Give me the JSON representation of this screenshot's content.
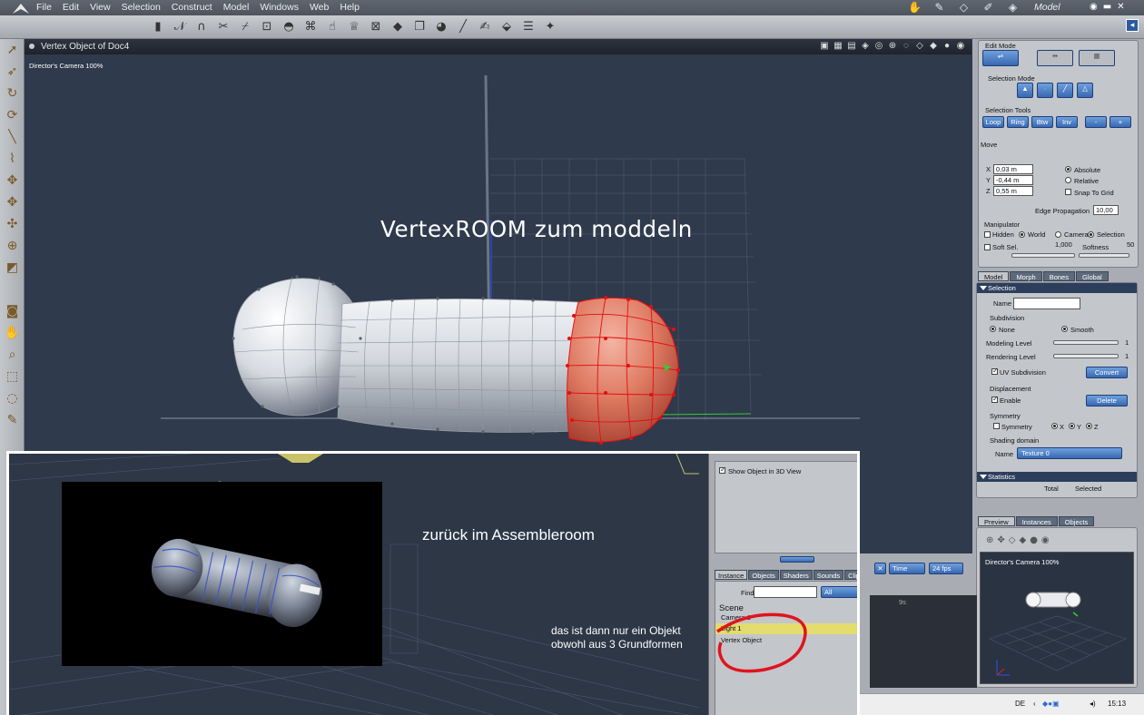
{
  "app": {
    "menu": [
      "File",
      "Edit",
      "View",
      "Selection",
      "Construct",
      "Model",
      "Windows",
      "Web",
      "Help"
    ],
    "room": "Model"
  },
  "viewport": {
    "title": "Vertex Object of Doc4",
    "camera_label": "Director's Camera 100%",
    "annotation": "VertexROOM zum moddeln"
  },
  "edit_panel": {
    "edit_mode_label": "Edit Mode",
    "selection_mode_label": "Selection Mode",
    "selection_tools_label": "Selection Tools",
    "selection_tools": [
      "Loop",
      "Ring",
      "Btw",
      "Inv",
      "-",
      "+"
    ],
    "move_label": "Move",
    "coords": [
      {
        "axis": "X",
        "value": "0,03 m"
      },
      {
        "axis": "Y",
        "value": "-0,44 m"
      },
      {
        "axis": "Z",
        "value": "0,55 m"
      }
    ],
    "absolute": "Absolute",
    "relative": "Relative",
    "snap": "Snap To Grid",
    "edge_propagation_label": "Edge Propagation",
    "edge_propagation_value": "10,00",
    "manipulator_label": "Manipulator",
    "manip_options": [
      "Hidden",
      "World",
      "Camera",
      "Selection"
    ],
    "soft_sel": "Soft Sel.",
    "soft_sel_value": "1,000",
    "softness": "Softness",
    "softness_value": "50"
  },
  "props_panel": {
    "tabs": [
      "Model",
      "Morph",
      "Bones",
      "Global"
    ],
    "selection_header": "Selection",
    "name_label": "Name",
    "subdivision_label": "Subdivision",
    "none": "None",
    "smooth": "Smooth",
    "modeling_level": "Modeling Level",
    "modeling_level_value": "1",
    "rendering_level": "Rendering Level",
    "rendering_level_value": "1",
    "uv_subdivision": "UV Subdivision",
    "convert": "Convert",
    "displacement_label": "Displacement",
    "enable": "Enable",
    "delete": "Delete",
    "symmetry_label": "Symmetry",
    "symmetry": "Symmetry",
    "sym_axes": [
      "X",
      "Y",
      "Z"
    ],
    "shading_domain_label": "Shading domain",
    "shading_name_label": "Name",
    "shading_value": "Texture 0",
    "statistics_header": "Statistics",
    "total": "Total",
    "selected": "Selected"
  },
  "preview_panel": {
    "tabs": [
      "Preview",
      "Instances",
      "Objects"
    ],
    "camera_label": "Director's Camera 100%"
  },
  "bottom": {
    "time_label": "Time",
    "fps_label": "24 fps",
    "timeline_mark": "9s"
  },
  "inset": {
    "show_object": "Show Object in 3D View",
    "tabs": [
      "Instance",
      "Objects",
      "Shaders",
      "Sounds",
      "Clip"
    ],
    "find_label": "Find:",
    "find_filter": "All",
    "scene_label": "Scene",
    "scene_items": [
      "Camera 1",
      "Light 1",
      "Vertex Object"
    ],
    "assemble_text": "zurück im Assembleroom",
    "note_line1": "das ist dann nur ein Objekt",
    "note_line2": "obwohl aus 3 Grundformen"
  },
  "taskbar": {
    "lang": "DE",
    "time": "15:13"
  },
  "colors": {
    "viewport_bg": "#2f3a4c",
    "selected_mesh": "#d9735f",
    "panel_bg": "#a9adb3",
    "accent_blue": "#3869b2",
    "highlight_row": "#e4dc6e",
    "circle_annotation": "#e0141c"
  }
}
